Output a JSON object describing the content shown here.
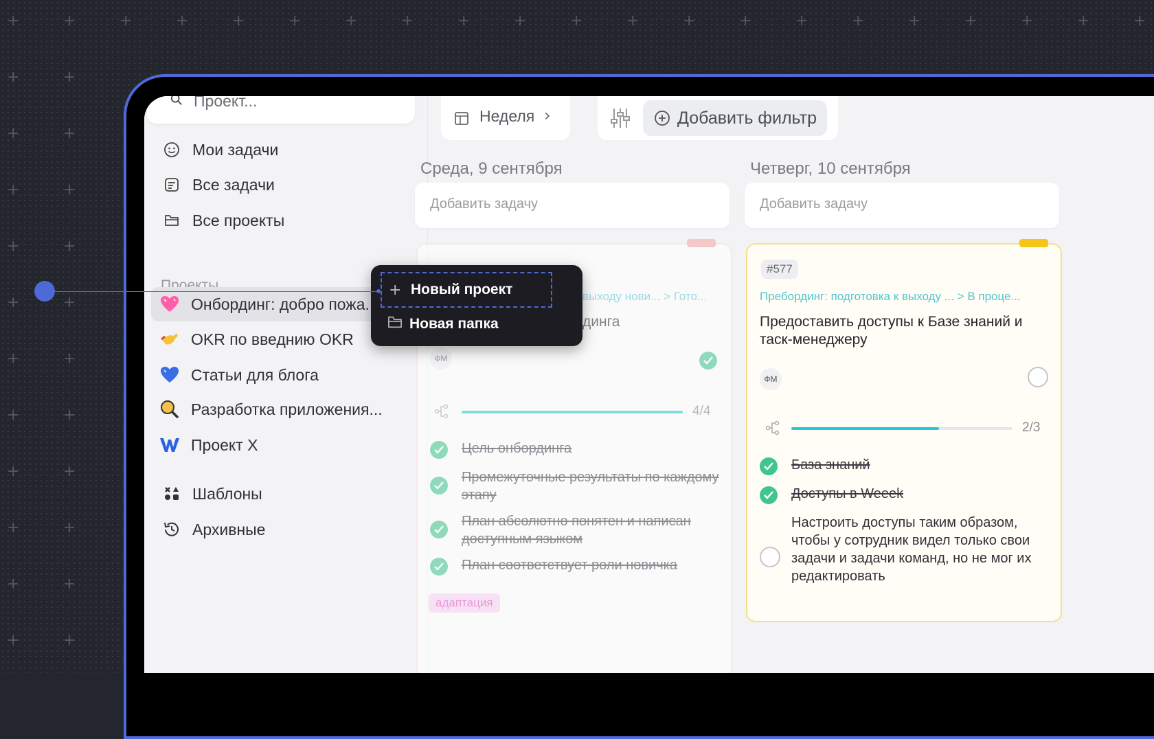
{
  "sidebar": {
    "search_placeholder": "Проект...",
    "nav": [
      {
        "label": "Мои задачи",
        "icon": "smile-icon"
      },
      {
        "label": "Все задачи",
        "icon": "list-icon"
      },
      {
        "label": "Все проекты",
        "icon": "folder-icon"
      }
    ],
    "projects_label": "Проекты",
    "projects": [
      {
        "label": "Онбординг: добро пожа...",
        "icon": "heart-icon",
        "active": true
      },
      {
        "label": "OKR по введнию OKR",
        "icon": "hand-icon"
      },
      {
        "label": "Статьи для блога",
        "icon": "blue-heart-icon"
      },
      {
        "label": "Разработка приложения...",
        "icon": "magnifier-icon"
      },
      {
        "label": "Проект X",
        "icon": "w-logo-icon"
      }
    ],
    "bottom": [
      {
        "label": "Шаблоны",
        "icon": "templates-icon"
      },
      {
        "label": "Архивные",
        "icon": "history-icon"
      }
    ]
  },
  "toolbar": {
    "week_label": "Неделя",
    "add_filter_label": "Добавить фильтр"
  },
  "columns": [
    {
      "day": "Среда, 9 сентября",
      "add_task": "Добавить задачу",
      "card": {
        "crumb": "выходу нови... > Гото...",
        "title_fragment": "динга",
        "avatar": "ФМ",
        "progress": {
          "done": 4,
          "total": 4,
          "label": "4/4"
        },
        "subtasks": [
          {
            "text": "Цель онбординга",
            "done": true
          },
          {
            "text": "Промежуточные результаты по каждому этапу",
            "done": true
          },
          {
            "text": "План абсолютно понятен и написан доступным языком",
            "done": true
          },
          {
            "text": "План соответствует роли новичка",
            "done": true
          }
        ],
        "tag": "адаптация",
        "accent": "#f4a5a5"
      }
    },
    {
      "day": "Четверг, 10 сентября",
      "add_task": "Добавить задачу",
      "card": {
        "id": "#577",
        "crumb": "Пребординг: подготовка к выходу ...  > В проце...",
        "title": "Предоставить доступы к Базе знаний и таск-менеджеру",
        "avatar": "ФМ",
        "progress": {
          "done": 2,
          "total": 3,
          "label": "2/3"
        },
        "subtasks": [
          {
            "text": "База знаний",
            "done": true
          },
          {
            "text": "Доступы в Weeek",
            "done": true
          },
          {
            "text": "Настроить доступы таким образом, чтобы у сотрудник видел только свои задачи и задачи команд, но не мог их редактировать",
            "done": false
          }
        ],
        "accent": "#f5c518"
      }
    }
  ],
  "menu": {
    "new_project": "Новый проект",
    "new_folder": "Новая папка"
  },
  "colors": {
    "accent_blue": "#4f69d6",
    "progress": "#25c6d6",
    "check_done": "#3fc58d",
    "tag_bg": "#fbd2f3",
    "tag_text": "#e24bc8"
  }
}
